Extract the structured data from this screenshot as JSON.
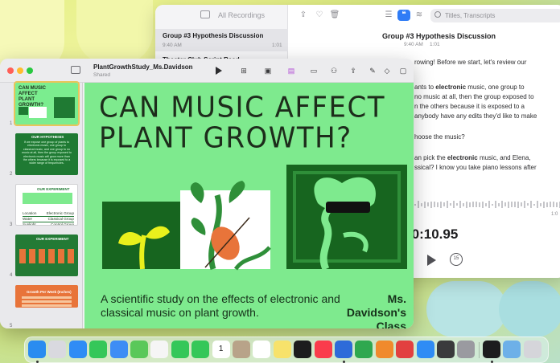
{
  "voice_memos": {
    "sidebar_title": "All Recordings",
    "recordings": [
      {
        "title": "Group #3 Hypothesis Discussion",
        "time": "9:40 AM",
        "duration": "1:01"
      },
      {
        "title": "Theater Club Script Read"
      }
    ],
    "search_placeholder": "Titles, Transcripts",
    "detail_title": "Group #3 Hypothesis Discussion",
    "detail_time": "9:40 AM",
    "detail_duration": "1:01",
    "transcript_lines": [
      "rowing! Before we start, let's review our",
      "",
      "ants to electronic music, one group to",
      "no music at all, then the group exposed to",
      "n the others because it is exposed to a",
      "anybody have any edits they'd like to make",
      "",
      "hoose the music?",
      "",
      "an pick the electronic music, and Elena,",
      "ssical? I know you take piano lessons after"
    ],
    "timer": ":0:10.95",
    "skip_label": "15",
    "end_tick": "1:0"
  },
  "keynote": {
    "doc_title": "PlantGrowthStudy_Ms.Davidson",
    "doc_subtitle": "Shared",
    "slide_numbers": [
      "1",
      "2",
      "3",
      "4",
      "5"
    ],
    "slide": {
      "title": "CAN MUSIC AFFECT PLANT GROWTH?",
      "subtitle": "A scientific study on the effects of electronic and classical music on plant growth.",
      "author": "Ms. Davidson's Class"
    },
    "thumb_headers": [
      "OUR HYPOTHESIS",
      "OUR EXPERIMENT",
      "OUR EXPERIMENT",
      "Growth Per Week (Inches)"
    ],
    "thumb2_text": "If we expose one group of plants to electronic music, one group to classical music, and one group to no music at all, then the group exposed to electronic music will grow more than the others because it is exposed to a wider range of frequencies.",
    "thumb3_rows": [
      [
        "Location",
        "Electronic Group"
      ],
      [
        "Water",
        "Classical Group"
      ],
      [
        "Sunlight",
        "Control Group"
      ]
    ]
  },
  "colors": {
    "slide_bg": "#7eea8e",
    "dark_green": "#1f7a33",
    "selection": "#e9c45a"
  },
  "dock_icons": [
    "finder-icon",
    "launchpad-icon",
    "safari-icon",
    "messages-icon",
    "mail-icon",
    "maps-icon",
    "photos-icon",
    "facetime-icon",
    "phone-icon",
    "calendar-icon",
    "contacts-icon",
    "reminders-icon",
    "notes-icon",
    "tv-icon",
    "music-icon",
    "keynote-icon",
    "numbers-icon",
    "pages-icon",
    "rocket-icon",
    "appstore-icon",
    "iphone-mirroring-icon",
    "settings-icon",
    "voice-memos-icon",
    "downloads-icon",
    "trash-icon"
  ],
  "dock_labels": {
    "calendar_day": "1"
  }
}
